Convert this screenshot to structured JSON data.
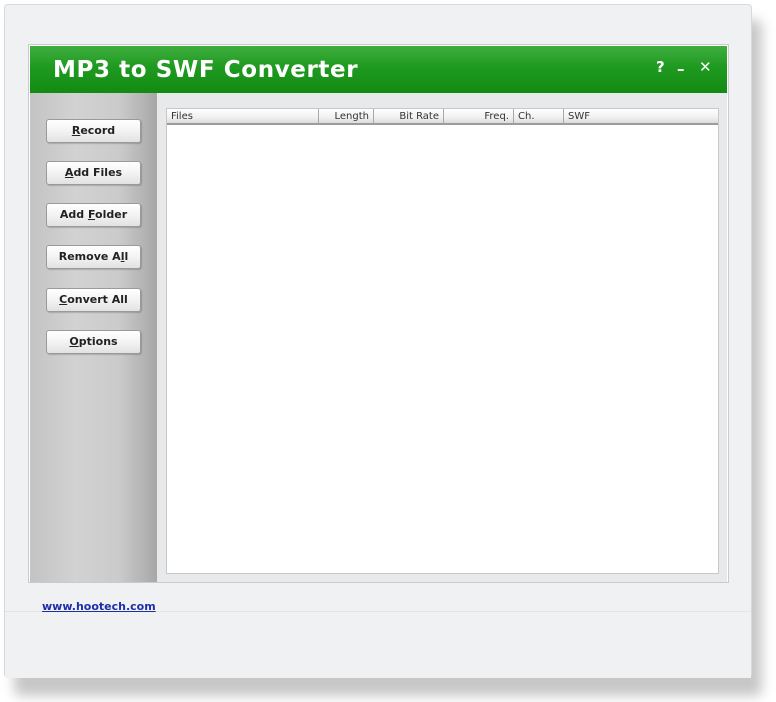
{
  "window": {
    "title": "MP3 to SWF Converter",
    "controls": {
      "help": "?",
      "minimize": "–",
      "close": "✕"
    }
  },
  "sidebar": {
    "buttons": [
      {
        "pre": "",
        "key": "R",
        "post": "ecord"
      },
      {
        "pre": "",
        "key": "A",
        "post": "dd Files"
      },
      {
        "pre": "Add ",
        "key": "F",
        "post": "older"
      },
      {
        "pre": "Remove A",
        "key": "l",
        "post": "l"
      },
      {
        "pre": "",
        "key": "C",
        "post": "onvert All"
      },
      {
        "pre": "",
        "key": "O",
        "post": "ptions"
      }
    ],
    "link": "www.hootech.com"
  },
  "file_list": {
    "columns": [
      "Files",
      "Length",
      "Bit Rate",
      "Freq.",
      "Ch.",
      "SWF"
    ],
    "rows": []
  },
  "colors": {
    "titlebar_green": "#1f9a20",
    "link_blue": "#1d2fa8"
  }
}
